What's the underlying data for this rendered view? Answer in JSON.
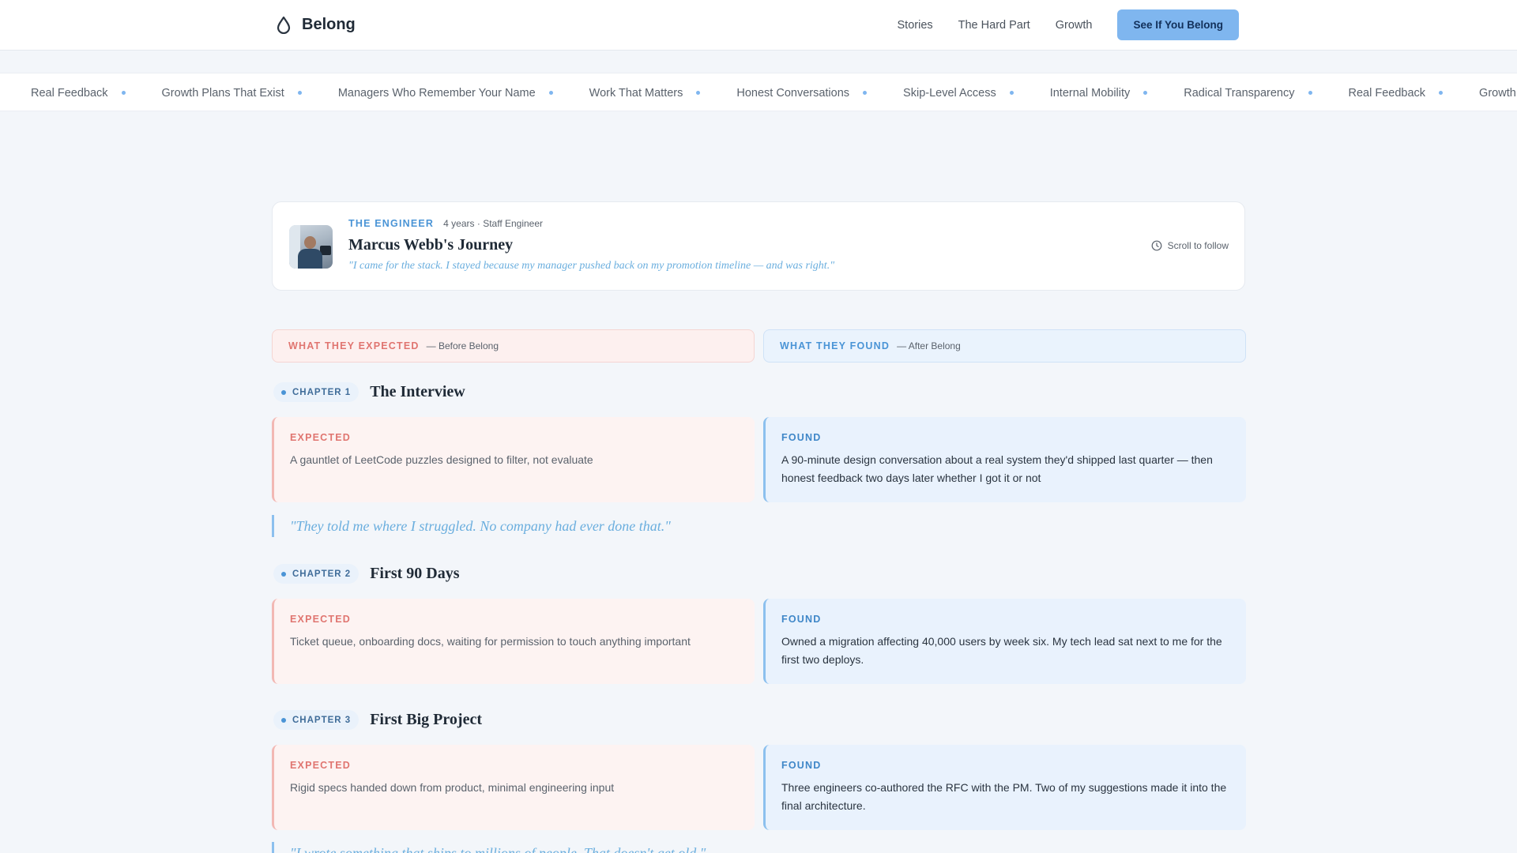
{
  "brand": {
    "name": "Belong",
    "icon": "drop-icon"
  },
  "nav": {
    "links": [
      "Stories",
      "The Hard Part",
      "Growth"
    ],
    "cta": "See If You Belong"
  },
  "ticker": [
    "Real Feedback",
    "Growth Plans That Exist",
    "Managers Who Remember Your Name",
    "Work That Matters",
    "Honest Conversations",
    "Skip-Level Access",
    "Internal Mobility",
    "Radical Transparency",
    "Real Feedback",
    "Growth Plans That Exist"
  ],
  "profile": {
    "role": "THE ENGINEER",
    "tenure": "4 years · Staff Engineer",
    "title": "Marcus Webb's Journey",
    "quote": "\"I came for the stack. I stayed because my manager pushed back on my promotion timeline — and was right.\"",
    "scroll_hint": "Scroll to follow"
  },
  "columns": {
    "expected": {
      "title": "WHAT THEY EXPECTED",
      "sub": "— Before Belong"
    },
    "found": {
      "title": "WHAT THEY FOUND",
      "sub": "— After Belong"
    }
  },
  "labels": {
    "expected": "EXPECTED",
    "found": "FOUND"
  },
  "chapters": [
    {
      "chip": "CHAPTER 1",
      "title": "The Interview",
      "expected": "A gauntlet of LeetCode puzzles designed to filter, not evaluate",
      "found": "A 90-minute design conversation about a real system they'd shipped last quarter — then honest feedback two days later whether I got it or not",
      "quote": "\"They told me where I struggled. No company had ever done that.\""
    },
    {
      "chip": "CHAPTER 2",
      "title": "First 90 Days",
      "expected": "Ticket queue, onboarding docs, waiting for permission to touch anything important",
      "found": "Owned a migration affecting 40,000 users by week six. My tech lead sat next to me for the first two deploys."
    },
    {
      "chip": "CHAPTER 3",
      "title": "First Big Project",
      "expected": "Rigid specs handed down from product, minimal engineering input",
      "found": "Three engineers co-authored the RFC with the PM. Two of my suggestions made it into the final architecture.",
      "quote": "\"I wrote something that ships to millions of people. That doesn't get old.\""
    }
  ]
}
